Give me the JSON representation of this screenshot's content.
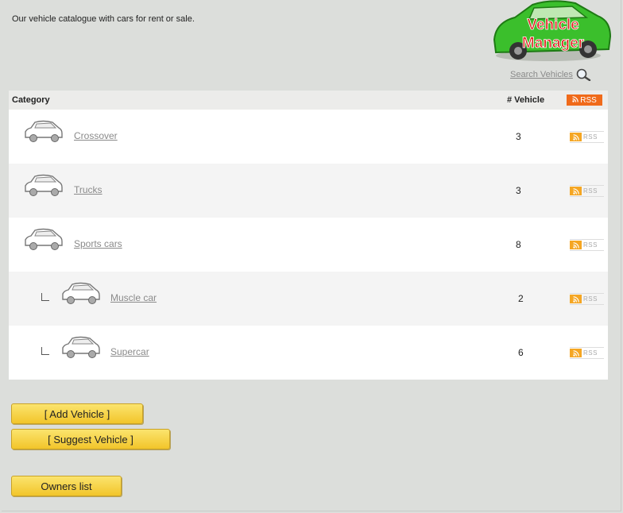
{
  "intro_text": "Our vehicle catalogue with cars for rent or sale.",
  "logo": {
    "line1": "Vehicle",
    "line2": "Manager"
  },
  "search": {
    "label": "Search Vehicles",
    "icon": "magnifier-icon"
  },
  "table": {
    "header": {
      "category": "Category",
      "count": "# Vehicle",
      "rss": "RSS"
    },
    "rows": [
      {
        "name": "Crossover",
        "count": "3",
        "level": 0,
        "rss": "RSS"
      },
      {
        "name": "Trucks",
        "count": "3",
        "level": 0,
        "rss": "RSS"
      },
      {
        "name": "Sports cars",
        "count": "8",
        "level": 0,
        "rss": "RSS"
      },
      {
        "name": "Muscle car",
        "count": "2",
        "level": 1,
        "rss": "RSS"
      },
      {
        "name": "Supercar",
        "count": "6",
        "level": 1,
        "rss": "RSS"
      }
    ]
  },
  "buttons": {
    "add": "[ Add Vehicle ]",
    "suggest": "[ Suggest Vehicle ]",
    "owners": "Owners list"
  },
  "colors": {
    "background": "#dcdedb",
    "rss_orange": "#f06a1a",
    "button_yellow": "#f2c52a",
    "logo_green": "#3bbf2c",
    "logo_red": "#e02020"
  }
}
